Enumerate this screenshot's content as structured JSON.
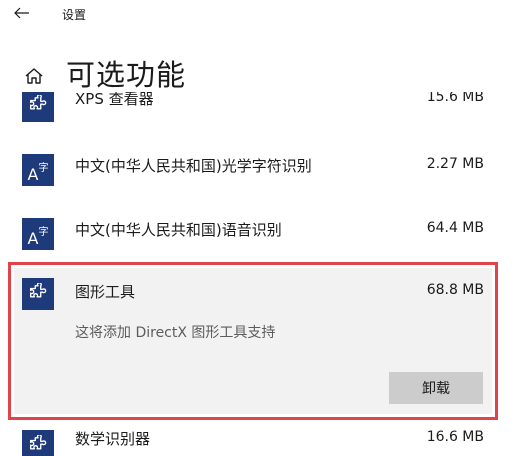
{
  "window": {
    "title": "设置"
  },
  "page": {
    "title": "可选功能"
  },
  "features": [
    {
      "name": "XPS 查看器",
      "size": "15.6 MB",
      "icon": "puzzle-icon"
    },
    {
      "name": "中文(中华人民共和国)光学字符识别",
      "size": "2.27 MB",
      "icon": "language-icon"
    },
    {
      "name": "中文(中华人民共和国)语音识别",
      "size": "64.4 MB",
      "icon": "language-icon"
    },
    {
      "name": "图形工具",
      "size": "68.8 MB",
      "icon": "puzzle-icon",
      "description": "这将添加 DirectX 图形工具支持",
      "button": "卸载"
    },
    {
      "name": "数学识别器",
      "size": "16.6 MB",
      "icon": "puzzle-icon"
    }
  ],
  "language_icon": {
    "big": "A",
    "small": "字"
  },
  "colors": {
    "tile": "#1e3a7a",
    "highlight_border": "#e2434b",
    "selected_bg": "#f2f2f2",
    "button_bg": "#cccccc"
  }
}
